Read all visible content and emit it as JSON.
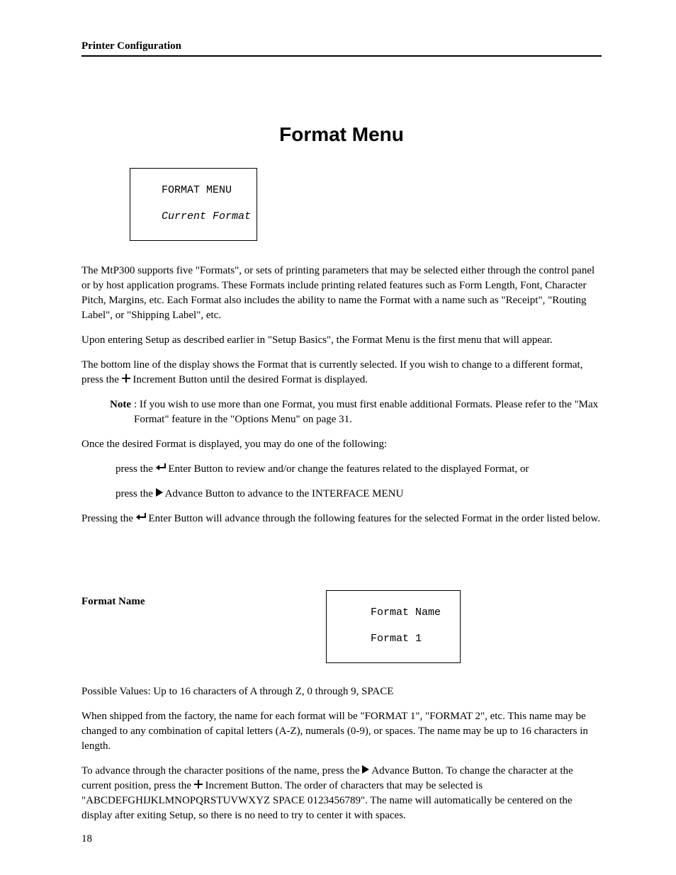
{
  "header": {
    "running_title": "Printer Configuration"
  },
  "title": "Format Menu",
  "lcd1": {
    "line1": "FORMAT MENU",
    "line2": "Current Format"
  },
  "para1": "The MtP300 supports five \"Formats\", or sets of printing parameters that may be selected either through the control panel or by host application programs.  These Formats include printing related features such as Form Length, Font, Character Pitch, Margins, etc.  Each Format also includes the ability to name the Format with a name such as \"Receipt\", \"Routing Label\", or \"Shipping Label\", etc.",
  "para2": "Upon entering Setup as described earlier in \"Setup Basics\", the Format Menu is the first menu that will appear.",
  "para3_a": "The bottom line of the display shows the Format that is currently selected.  If you wish to change to a different format, press the ",
  "para3_b": " Increment Button until the desired Format is displayed.",
  "note": {
    "label": "Note",
    "text": ":   If you wish to use more than one Format, you must first enable additional Formats.  Please refer to the \"Max Format\" feature in the \"Options Menu\" on page 31."
  },
  "para4": "Once the desired Format is displayed, you may do one of the following:",
  "bullet1_a": "press the ",
  "bullet1_b": " Enter Button to review and/or change the features related to the displayed Format, or",
  "bullet2_a": "press the ",
  "bullet2_b": " Advance Button to advance to the INTERFACE MENU",
  "para5_a": "Pressing the ",
  "para5_b": " Enter Button will advance through the following features for the selected Format in the order listed below.",
  "section": {
    "label": "Format Name",
    "lcd_line1": "Format Name",
    "lcd_line2": "Format 1"
  },
  "para6": "Possible Values:  Up to 16 characters of A through Z, 0 through 9, SPACE",
  "para7": "When shipped from the factory, the name for each format will be \"FORMAT 1\", \"FORMAT 2\", etc.  This name may be changed to any combination of capital letters (A-Z), numerals (0-9), or spaces.  The name may be up to 16 characters in length.",
  "para8_a": "To advance through the character positions of the name, press the ",
  "para8_b": " Advance Button.  To change the character at the current position, press the ",
  "para8_c": " Increment Button.  The order of characters that may be selected is \"ABCDEFGHIJKLMNOPQRSTUVWXYZ  SPACE  0123456789\".  The name will automatically be centered on the display after exiting Setup, so there is no need to try to center it with spaces.",
  "page_number": "18"
}
